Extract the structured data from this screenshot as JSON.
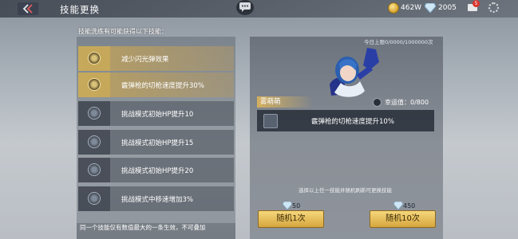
{
  "header": {
    "title": "技能更换",
    "gold": "462W",
    "diamonds": "2005",
    "mail_badge": "5"
  },
  "left": {
    "header": "技能洗练有可能获得以下技能：",
    "items": [
      {
        "label": "减少闪光弹效果"
      },
      {
        "label": "霰弹枪的切枪速度提升30%"
      },
      {
        "label": "挑战模式初始HP提升10"
      },
      {
        "label": "挑战模式初始HP提升15"
      },
      {
        "label": "挑战模式初始HP提升20"
      },
      {
        "label": "挑战模式中移速增加3%"
      }
    ],
    "footer": "同一个技能仅有数值最大的一条生效，不可叠加"
  },
  "right": {
    "daily_limit": "今日上限0/0000/1000000次",
    "character_name": "雾萌萌",
    "luck": "幸运值：0/800",
    "current_skill": "霰弹枪的切枪速度提升10%",
    "hint": "选择以上任一技能并随机刷新可更换技能",
    "random_one": {
      "cost": "50",
      "label": "随机1次"
    },
    "random_ten": {
      "cost": "450",
      "label": "随机10次"
    }
  },
  "colors": {
    "accent_gold": "#d6a63d",
    "highlight_row": "#be a05a"
  }
}
